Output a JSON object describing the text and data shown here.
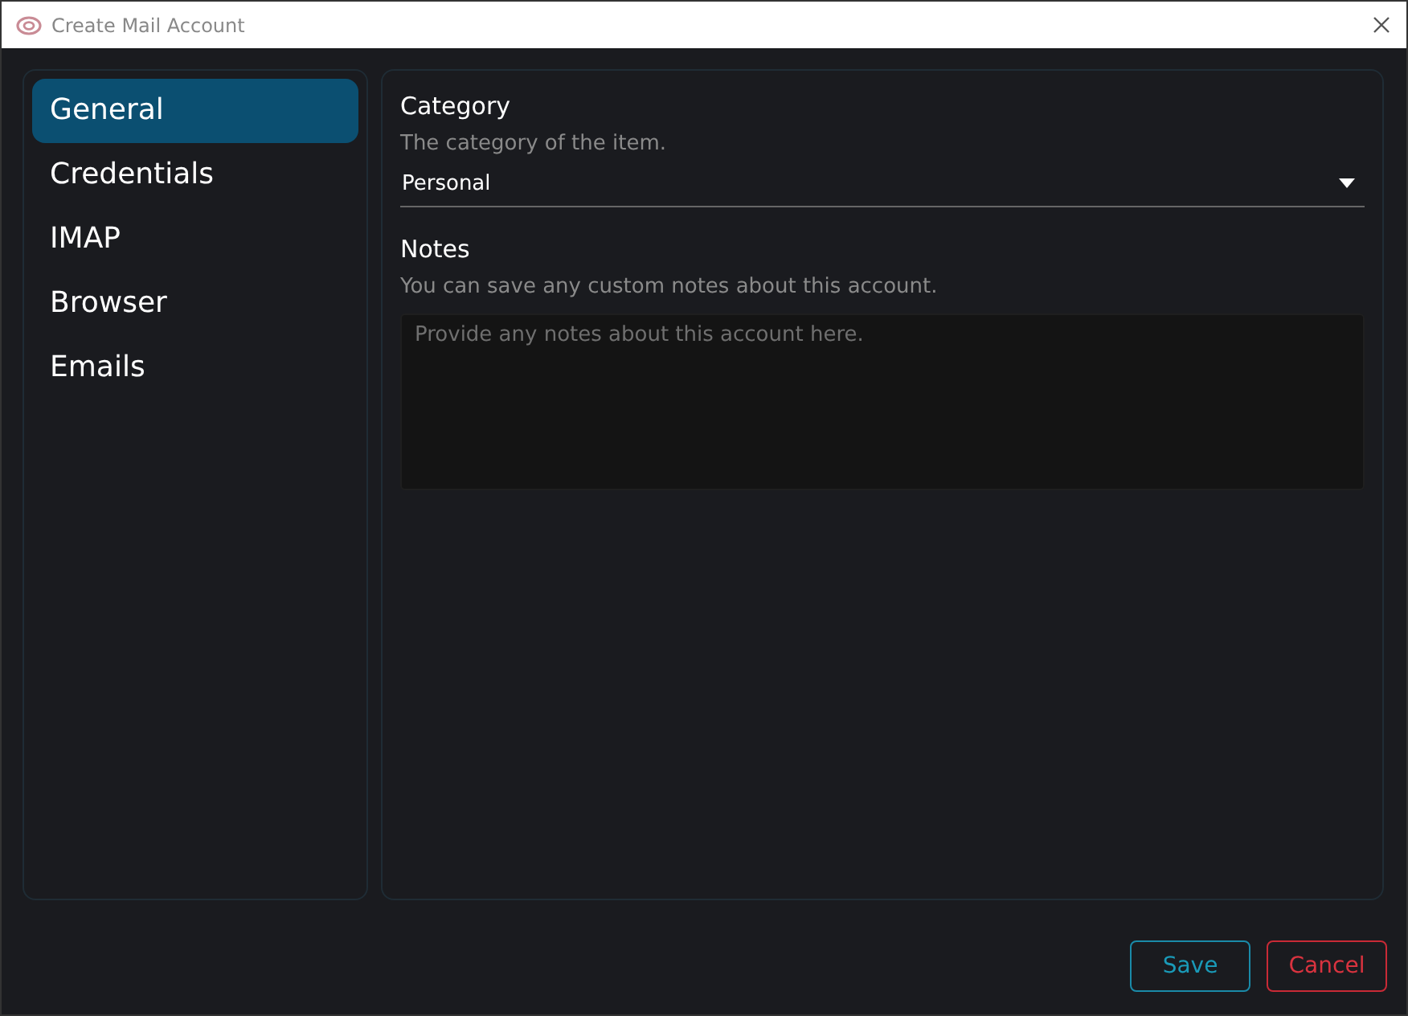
{
  "window": {
    "title": "Create Mail Account"
  },
  "sidebar": {
    "items": [
      {
        "label": "General",
        "selected": true
      },
      {
        "label": "Credentials",
        "selected": false
      },
      {
        "label": "IMAP",
        "selected": false
      },
      {
        "label": "Browser",
        "selected": false
      },
      {
        "label": "Emails",
        "selected": false
      }
    ]
  },
  "category": {
    "label": "Category",
    "description": "The category of the item.",
    "value": "Personal"
  },
  "notes": {
    "label": "Notes",
    "description": "You can save any custom notes about this account.",
    "placeholder": "Provide any notes about this account here."
  },
  "buttons": [
    {
      "label": "Save",
      "kind": "primary"
    },
    {
      "label": "Cancel",
      "kind": "danger"
    }
  ]
}
